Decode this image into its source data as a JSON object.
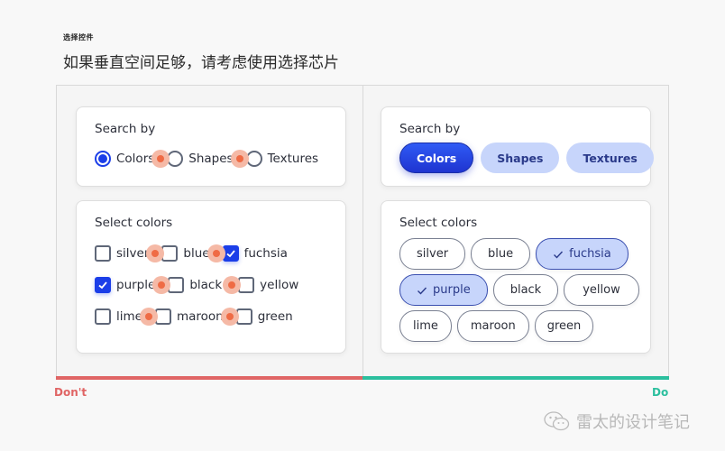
{
  "eyebrow": "选择控件",
  "headline": "如果垂直空间足够，请考虑使用选择芯片",
  "dont": {
    "label": "Don't",
    "color": "#e06565",
    "search_card": {
      "title": "Search by",
      "options": [
        {
          "label": "Colors",
          "selected": true
        },
        {
          "label": "Shapes",
          "selected": false
        },
        {
          "label": "Textures",
          "selected": false
        }
      ]
    },
    "select_card": {
      "title": "Select colors",
      "rows": [
        [
          {
            "label": "silver",
            "checked": false
          },
          {
            "label": "blue",
            "checked": false
          },
          {
            "label": "fuchsia",
            "checked": true
          }
        ],
        [
          {
            "label": "purple",
            "checked": true
          },
          {
            "label": "black",
            "checked": false
          },
          {
            "label": "yellow",
            "checked": false
          }
        ],
        [
          {
            "label": "lime",
            "checked": false
          },
          {
            "label": "maroon",
            "checked": false
          },
          {
            "label": "green",
            "checked": false
          }
        ]
      ]
    }
  },
  "do": {
    "label": "Do",
    "color": "#2bbf9e",
    "search_card": {
      "title": "Search by",
      "options": [
        {
          "label": "Colors",
          "selected": true
        },
        {
          "label": "Shapes",
          "selected": false
        },
        {
          "label": "Textures",
          "selected": false
        }
      ]
    },
    "select_card": {
      "title": "Select colors",
      "rows": [
        [
          {
            "label": "silver",
            "checked": false
          },
          {
            "label": "blue",
            "checked": false
          },
          {
            "label": "fuchsia",
            "checked": true
          }
        ],
        [
          {
            "label": "purple",
            "checked": true
          },
          {
            "label": "black",
            "checked": false
          },
          {
            "label": "yellow",
            "checked": false
          }
        ],
        [
          {
            "label": "lime",
            "checked": false
          },
          {
            "label": "maroon",
            "checked": false
          },
          {
            "label": "green",
            "checked": false
          }
        ]
      ]
    }
  },
  "colors": {
    "accent": "#1b3ee8",
    "chip_selected_bg": "#c7d5fb",
    "touch_indicator": "#ef6b45"
  },
  "watermark": {
    "icon": "wechat-icon",
    "text": "雷太的设计笔记"
  }
}
